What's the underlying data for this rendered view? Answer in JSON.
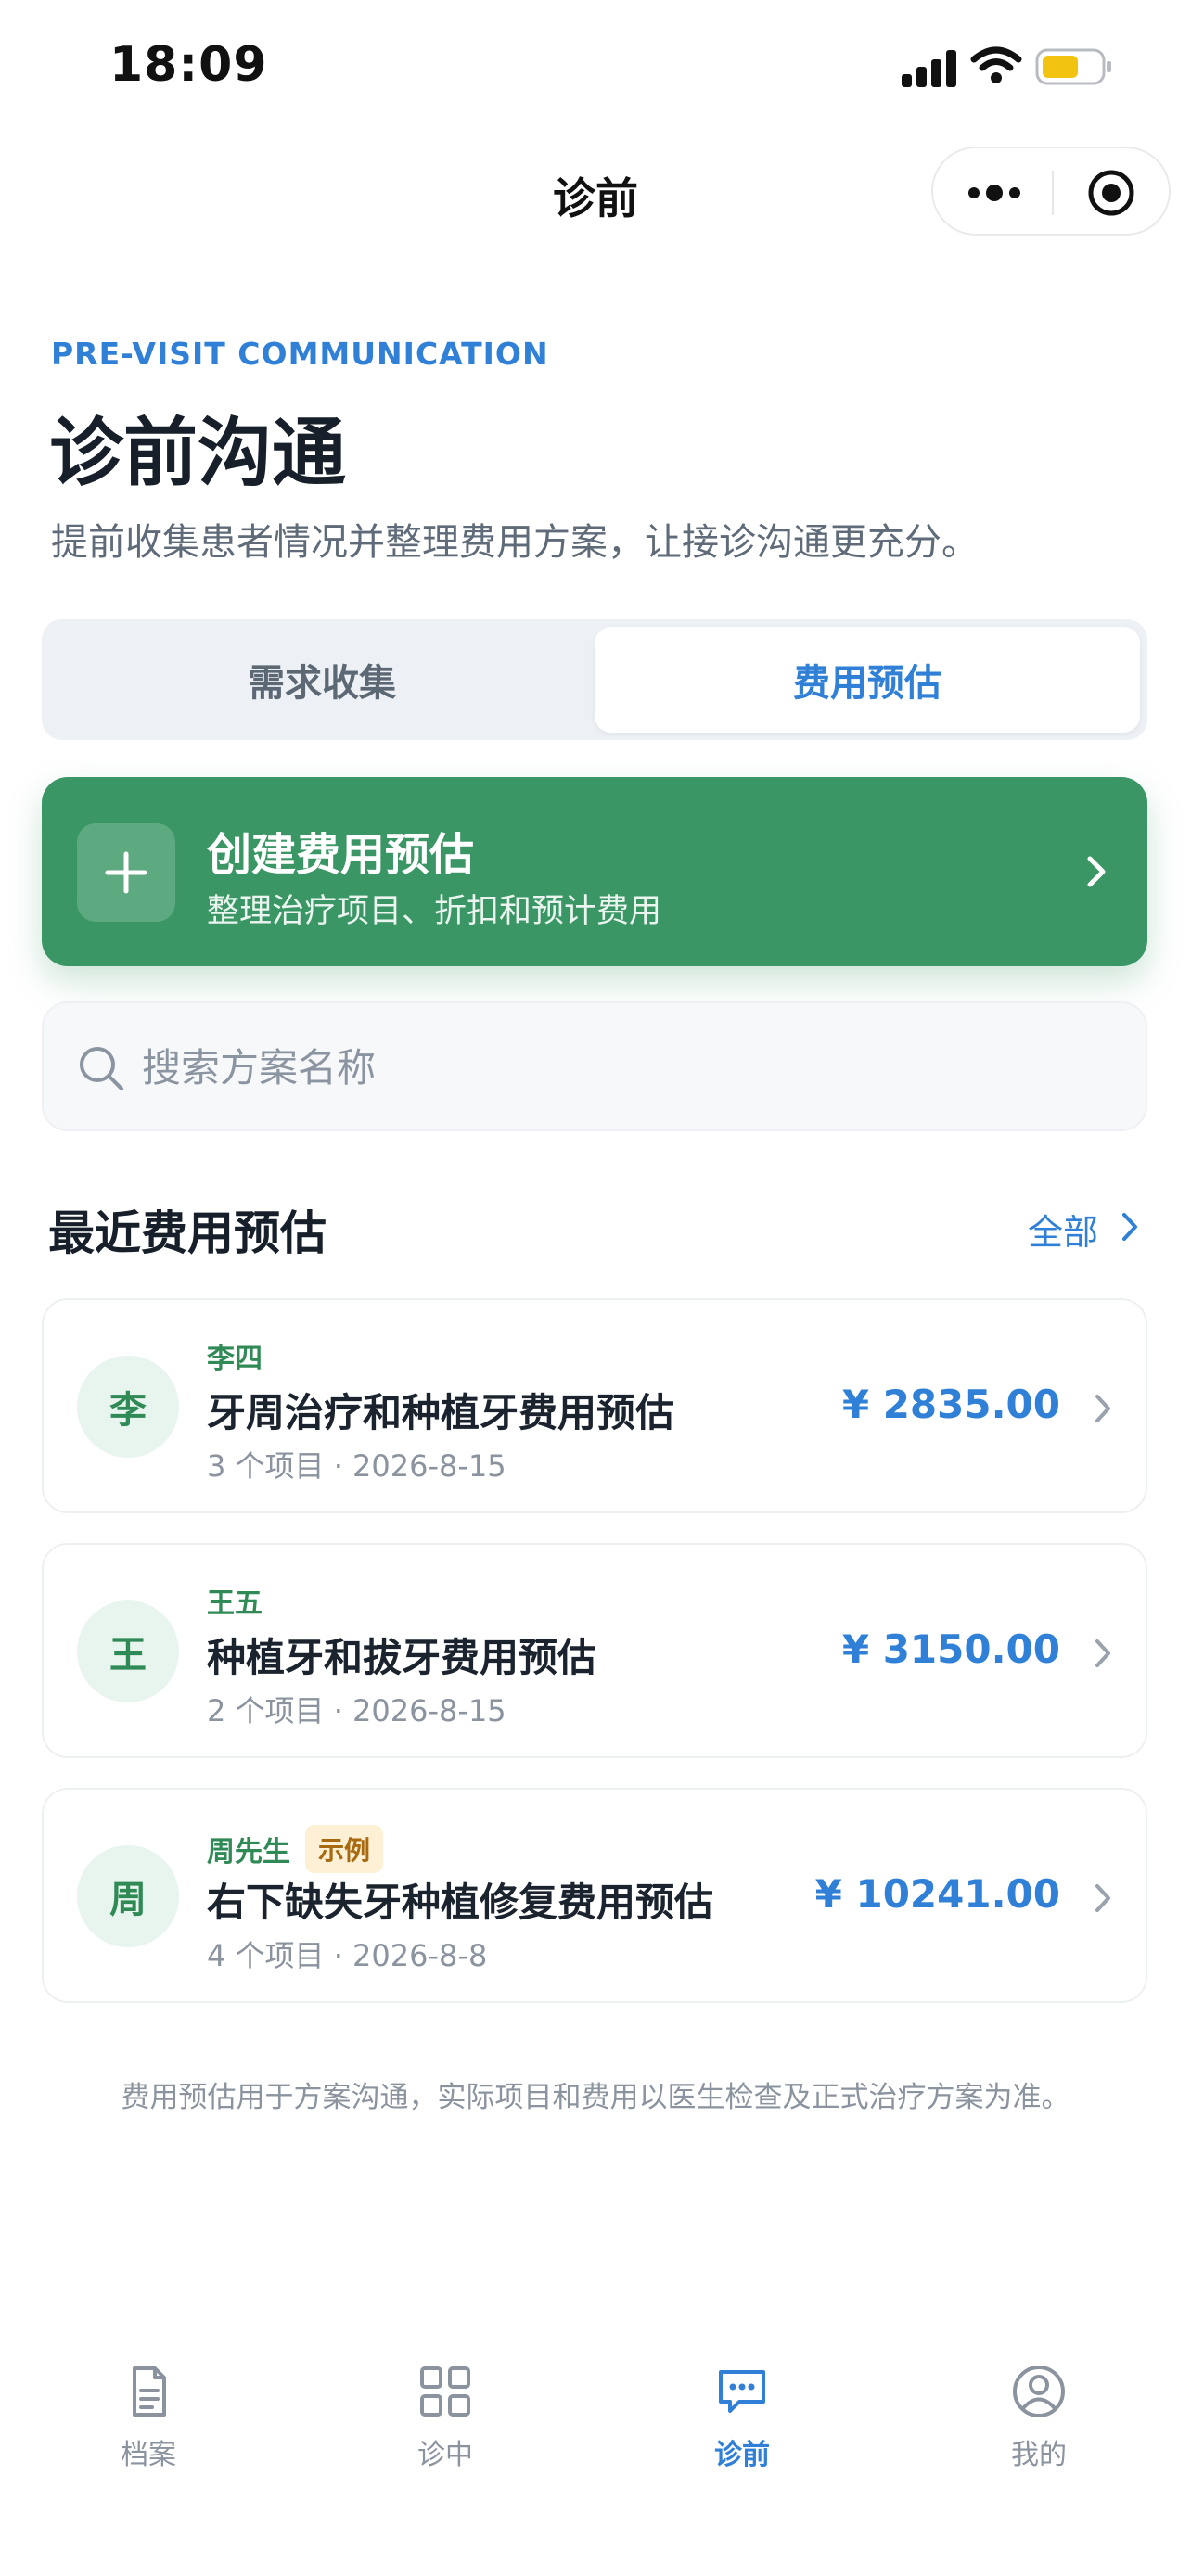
{
  "status_bar": {
    "time": "18:09"
  },
  "nav": {
    "title": "诊前"
  },
  "header": {
    "eyebrow": "PRE-VISIT COMMUNICATION",
    "title": "诊前沟通",
    "subtitle": "提前收集患者情况并整理费用方案，让接诊沟通更充分。"
  },
  "tabs": {
    "left": "需求收集",
    "right": "费用预估",
    "active": "费用预估"
  },
  "create": {
    "title": "创建费用预估",
    "desc": "整理治疗项目、折扣和预计费用"
  },
  "search": {
    "placeholder": "搜索方案名称"
  },
  "recent": {
    "title": "最近费用预估",
    "see_all": "全部",
    "items": [
      {
        "avatar": "李",
        "patient": "李四",
        "badge": "",
        "name": "牙周治疗和种植牙费用预估",
        "meta": "3 个项目 · 2026-8-15",
        "amount": "¥ 2835.00"
      },
      {
        "avatar": "王",
        "patient": "王五",
        "badge": "",
        "name": "种植牙和拔牙费用预估",
        "meta": "2 个项目 · 2026-8-15",
        "amount": "¥ 3150.00"
      },
      {
        "avatar": "周",
        "patient": "周先生",
        "badge": "示例",
        "name": "右下缺失牙种植修复费用预估",
        "meta": "4 个项目 · 2026-8-8",
        "amount": "¥ 10241.00"
      }
    ]
  },
  "disclaimer": "费用预估用于方案沟通，实际项目和费用以医生检查及正式治疗方案为准。",
  "tabbar": [
    {
      "label": "档案",
      "icon": "document-icon"
    },
    {
      "label": "诊中",
      "icon": "grid-icon"
    },
    {
      "label": "诊前",
      "icon": "chat-icon",
      "active": true
    },
    {
      "label": "我的",
      "icon": "user-icon"
    }
  ],
  "colors": {
    "accent": "#2f80d6",
    "brand_green": "#3a9665",
    "badge_bg": "#fdf0d5"
  }
}
